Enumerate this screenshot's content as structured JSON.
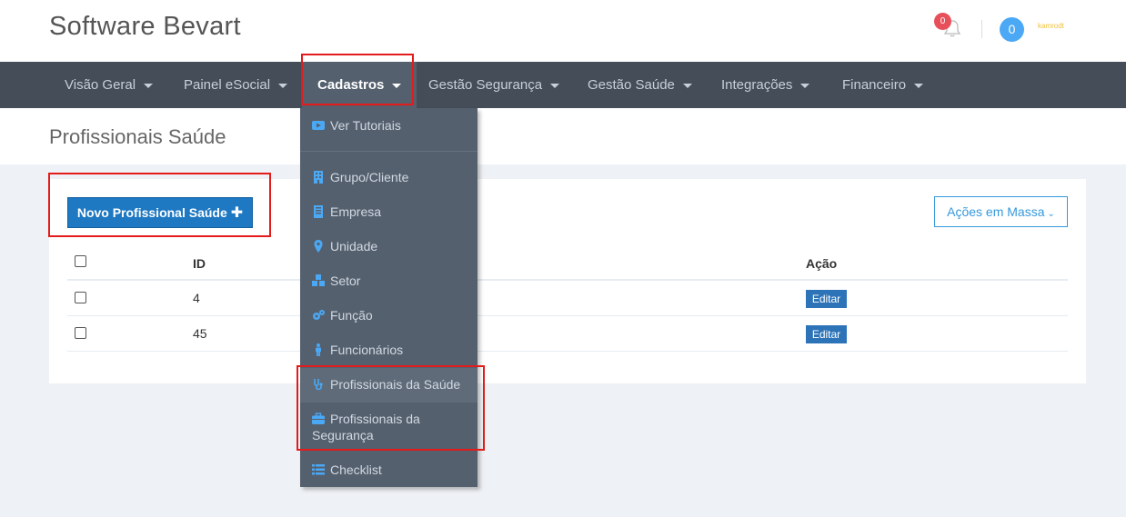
{
  "header": {
    "app_title": "Software Bevart",
    "notification_count": "0",
    "user_initial": "0",
    "user_name": "kamrodt"
  },
  "nav": {
    "items": [
      {
        "label": "Visão Geral"
      },
      {
        "label": "Painel eSocial"
      },
      {
        "label": "Cadastros"
      },
      {
        "label": "Gestão Segurança"
      },
      {
        "label": "Gestão Saúde"
      },
      {
        "label": "Integrações"
      },
      {
        "label": "Financeiro"
      }
    ],
    "active_index": 2
  },
  "page": {
    "title": "Profissionais Saúde"
  },
  "panel": {
    "new_button": "Novo Profissional Saúde",
    "mass_actions": "Ações em Massa"
  },
  "table": {
    "columns": {
      "id": "ID",
      "action": "Ação"
    },
    "rows": [
      {
        "id": "4",
        "action": "Editar"
      },
      {
        "id": "45",
        "action": "Editar"
      }
    ]
  },
  "dropdown": {
    "items": [
      {
        "label": "Ver Tutoriais",
        "icon": "video-icon"
      },
      {
        "label": "Grupo/Cliente",
        "icon": "building-icon"
      },
      {
        "label": "Empresa",
        "icon": "building-icon"
      },
      {
        "label": "Unidade",
        "icon": "map-marker-icon"
      },
      {
        "label": "Setor",
        "icon": "cubes-icon"
      },
      {
        "label": "Função",
        "icon": "cogs-icon"
      },
      {
        "label": "Funcionários",
        "icon": "person-icon"
      },
      {
        "label": "Profissionais da Saúde",
        "icon": "stethoscope-icon"
      },
      {
        "label": "Profissionais da Segurança",
        "icon": "briefcase-icon"
      },
      {
        "label": "Checklist",
        "icon": "list-icon"
      }
    ]
  },
  "colors": {
    "nav_bg": "#444d58",
    "dropdown_bg": "#55606e",
    "primary": "#1e78c2",
    "highlight": "#e31b1b",
    "icon_blue": "#4aa8f5"
  }
}
